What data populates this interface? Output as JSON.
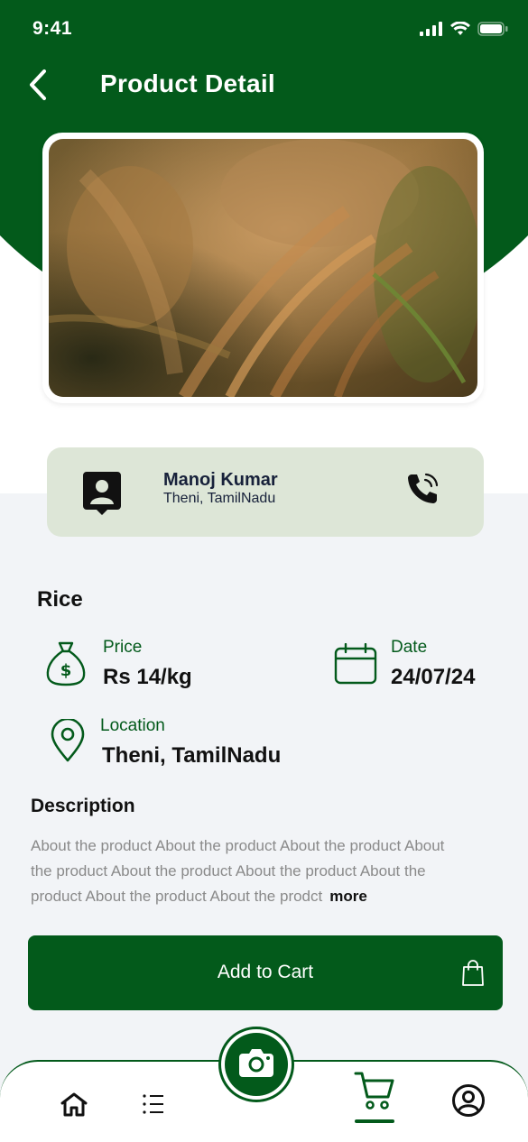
{
  "status_bar": {
    "time": "9:41"
  },
  "header": {
    "title": "Product Detail"
  },
  "seller": {
    "name": "Manoj Kumar",
    "location": "Theni, TamilNadu"
  },
  "product": {
    "name": "Rice",
    "price_label": "Price",
    "price_value": "Rs 14/kg",
    "date_label": "Date",
    "date_value": "24/07/24",
    "location_label": "Location",
    "location_value": "Theni, TamilNadu"
  },
  "description": {
    "title": "Description",
    "text": "About the product About the product About the product About the product About the product About the product About the product About the product About the prodct",
    "more_label": "more"
  },
  "add_to_cart_label": "Add to Cart",
  "bottom_nav": {
    "items": [
      "home",
      "list",
      "camera",
      "cart",
      "profile"
    ],
    "active": "cart"
  },
  "colors": {
    "brand_green": "#035a1b",
    "seller_card_bg": "#dde6d7",
    "panel_bg": "#f2f4f7"
  }
}
